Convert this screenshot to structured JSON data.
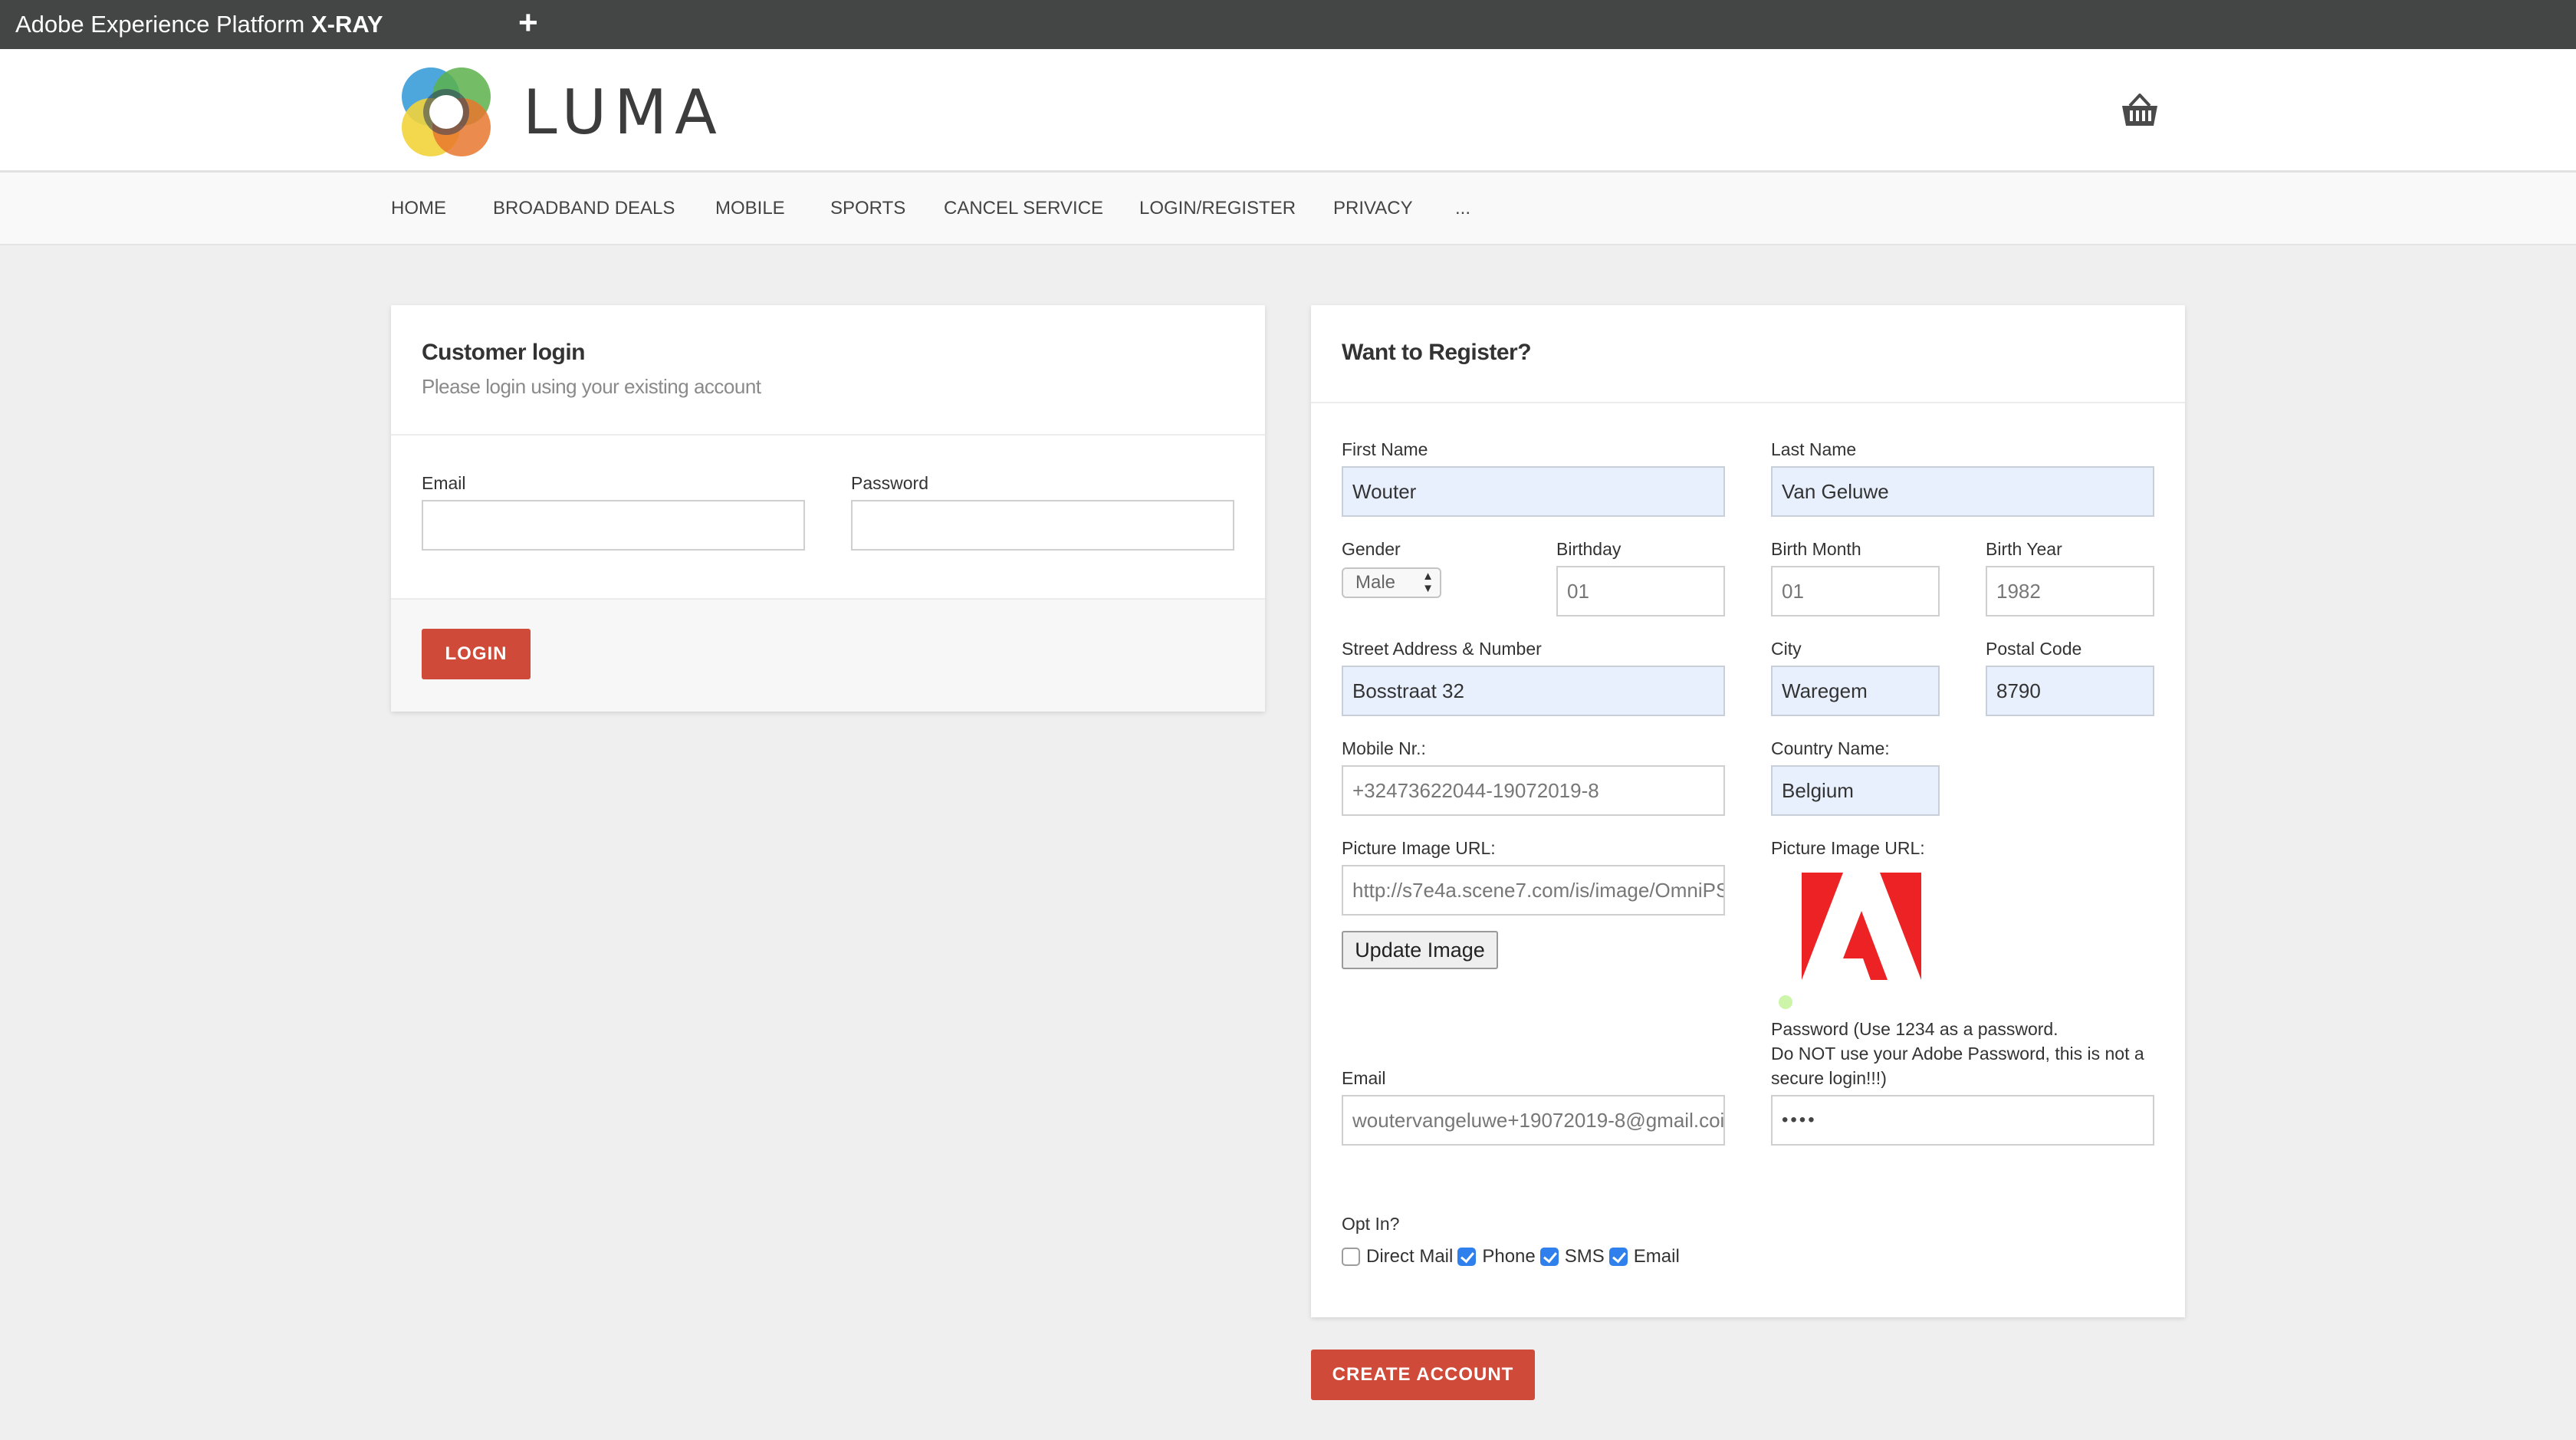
{
  "xray_bar": {
    "title_regular": "Adobe Experience Platform",
    "title_bold": "X-RAY",
    "new_tab_symbol": "+"
  },
  "header": {
    "brand": "LUMA",
    "logo_icon": "luma-logo",
    "cart_icon": "basket-icon"
  },
  "nav": {
    "items": [
      "HOME",
      "BROADBAND DEALS",
      "MOBILE",
      "SPORTS",
      "CANCEL SERVICE",
      "LOGIN/REGISTER",
      "PRIVACY",
      "..."
    ]
  },
  "login": {
    "title": "Customer login",
    "subtitle": "Please login using your existing account",
    "email_label": "Email",
    "email_value": "",
    "password_label": "Password",
    "password_value": "",
    "login_button": "LOGIN"
  },
  "register": {
    "title": "Want to Register?",
    "first_name_label": "First Name",
    "first_name_value": "Wouter",
    "last_name_label": "Last Name",
    "last_name_value": "Van Geluwe",
    "gender_label": "Gender",
    "gender_value": "Male",
    "birthday_label": "Birthday",
    "birthday_value": "01",
    "birth_month_label": "Birth Month",
    "birth_month_value": "01",
    "birth_year_label": "Birth Year",
    "birth_year_value": "1982",
    "street_label": "Street Address & Number",
    "street_value": "Bosstraat 32",
    "city_label": "City",
    "city_value": "Waregem",
    "postal_label": "Postal Code",
    "postal_value": "8790",
    "mobile_label": "Mobile Nr.:",
    "mobile_value": "+32473622044-19072019-8",
    "country_label": "Country Name:",
    "country_value": "Belgium",
    "picture_url_label": "Picture Image URL:",
    "picture_url_value": "http://s7e4a.scene7.com/is/image/OmniPS",
    "update_image_button": "Update Image",
    "picture_preview_label": "Picture Image URL:",
    "password_note_1": "Password (Use 1234 as a password.",
    "password_note_2": "Do NOT use your Adobe Password, this is not a",
    "password_note_3": "secure login!!!)",
    "email_label": "Email",
    "email_value": "woutervangeluwe+19072019-8@gmail.coi",
    "password_value": "••••",
    "opt_in_label": "Opt In?",
    "opt_in": [
      {
        "label": "Direct Mail",
        "checked": false
      },
      {
        "label": "Phone",
        "checked": true
      },
      {
        "label": "SMS",
        "checked": true
      },
      {
        "label": "Email",
        "checked": true
      }
    ],
    "create_account_button": "CREATE ACCOUNT"
  },
  "colors": {
    "accent_red": "#d04a3a",
    "autofill_blue": "#e8f0fe",
    "xray_bar": "#444545",
    "checkbox_blue": "#2f80ed"
  }
}
